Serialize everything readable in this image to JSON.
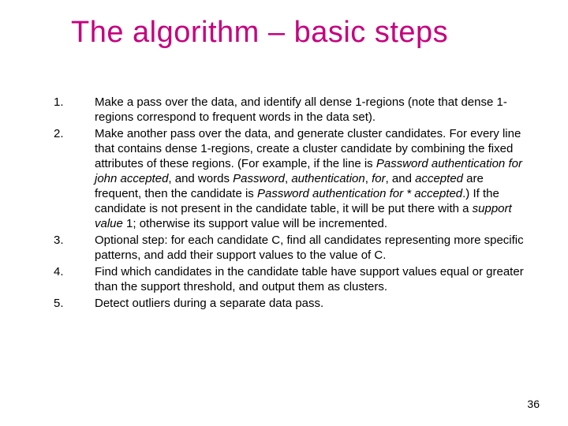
{
  "title": "The algorithm – basic steps",
  "items": [
    {
      "num": "1.",
      "html": "Make a pass over the data, and identify all dense 1-regions (note that dense 1-regions correspond to frequent words in the data set)."
    },
    {
      "num": "2.",
      "html": "Make another pass over the data, and generate cluster candidates. For every line that contains dense 1-regions, create a cluster candidate by combining the fixed attributes of these regions. (For example, if the line is <i>Password authentication for john accepted</i>, and words <i>Password</i>, <i>authentication</i>, <i>for</i>, and <i>accepted</i> are frequent, then the candidate is <i>Password authentication for * accepted</i>.) If the candidate is not present in the candidate table, it will be put there with a <i>support value</i> 1; otherwise its support value will be incremented."
    },
    {
      "num": "3.",
      "html": "Optional step: for each candidate C, find all candidates representing more specific patterns, and add their support values to the value of C."
    },
    {
      "num": "4.",
      "html": "Find which candidates in the candidate table have support values equal or greater than the support threshold, and output them as clusters."
    },
    {
      "num": "5.",
      "html": "Detect outliers during a separate data pass."
    }
  ],
  "page_number": "36"
}
